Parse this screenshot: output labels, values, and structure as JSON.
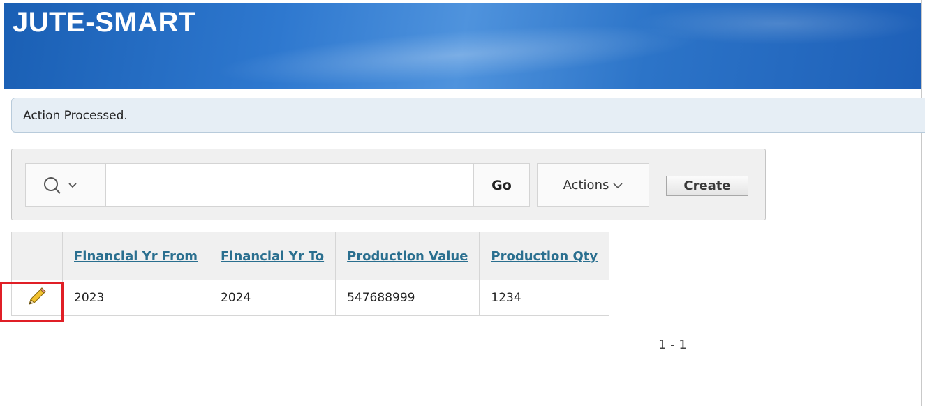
{
  "header": {
    "title": "JUTE-SMART"
  },
  "message": {
    "text": "Action Processed."
  },
  "toolbar": {
    "search_icon": "magnifier-icon",
    "search_value": "",
    "go_label": "Go",
    "actions_label": "Actions",
    "create_label": "Create"
  },
  "table": {
    "columns": [
      "Financial Yr From",
      "Financial Yr To",
      "Production Value",
      "Production Qty"
    ],
    "rows": [
      {
        "edit_icon": "pencil-icon",
        "financial_yr_from": "2023",
        "financial_yr_to": "2024",
        "production_value": "547688999",
        "production_qty": "1234"
      }
    ]
  },
  "pagination": {
    "text": "1 - 1"
  },
  "colors": {
    "header_blue": "#2e78cf",
    "link": "#2a6f8f",
    "highlight": "#e01f26"
  }
}
